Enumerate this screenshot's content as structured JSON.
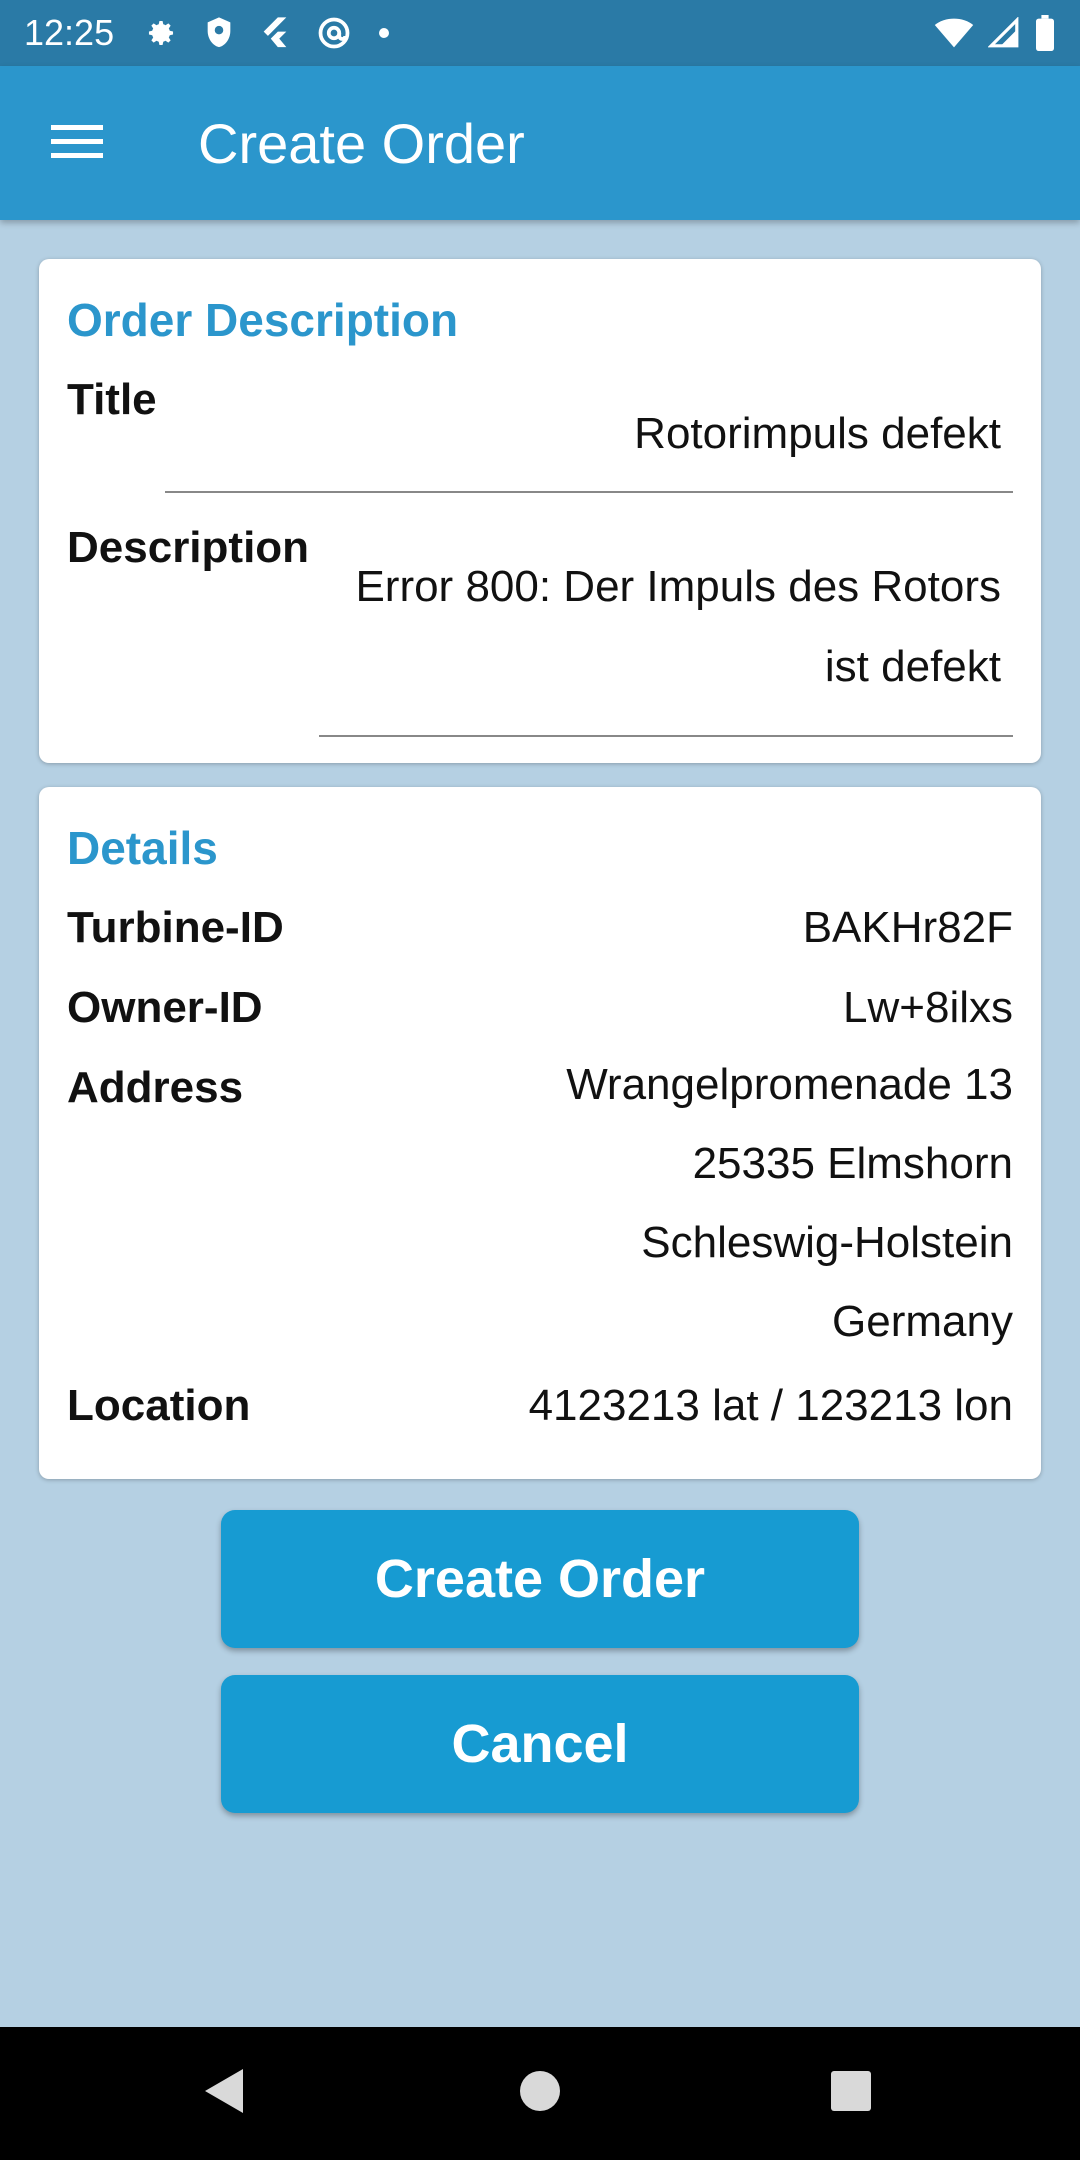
{
  "status_bar": {
    "time": "12:25",
    "left_icons": [
      "settings-icon",
      "shield-icon",
      "flutter-icon",
      "at-sign-icon",
      "dot-icon"
    ],
    "right_icons": [
      "wifi-icon",
      "signal-icon",
      "battery-icon"
    ]
  },
  "app_bar": {
    "title": "Create Order",
    "menu_icon": "hamburger-menu-icon"
  },
  "order_description": {
    "heading": "Order Description",
    "title_label": "Title",
    "title_value": "Rotorimpuls defekt",
    "description_label": "Description",
    "description_line1": "Error 800: Der Impuls des Rotors",
    "description_line2": "ist defekt"
  },
  "details": {
    "heading": "Details",
    "turbine_id_label": "Turbine-ID",
    "turbine_id": "BAKHr82F",
    "owner_id_label": "Owner-ID",
    "owner_id": "Lw+8ilxs",
    "address_label": "Address",
    "address_lines": [
      "Wrangelpromenade 13",
      "25335 Elmshorn",
      "Schleswig-Holstein",
      "Germany"
    ],
    "location_label": "Location",
    "location": "4123213 lat / 123213 lon"
  },
  "actions": {
    "create_label": "Create Order",
    "cancel_label": "Cancel"
  },
  "colors": {
    "status_bar": "#2a7aa6",
    "app_bar": "#2b96cc",
    "background": "#b5d0e3",
    "accent": "#2b96cc",
    "button": "#179bd2"
  },
  "nav_bar": {
    "icons": [
      "back-icon",
      "home-icon",
      "recents-icon"
    ]
  }
}
